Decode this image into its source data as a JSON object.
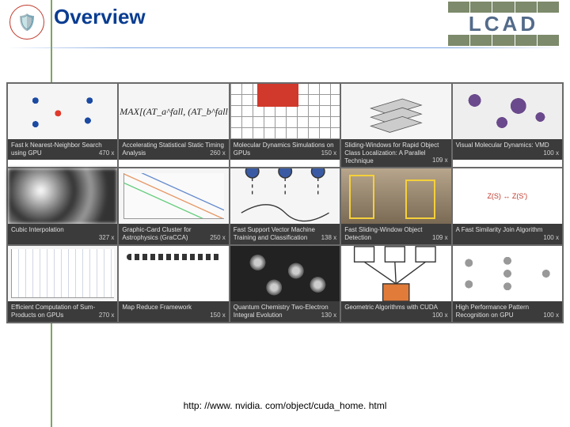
{
  "header": {
    "title": "Overview",
    "lab": "LCAD",
    "crest_glyph": "🛡️"
  },
  "cards": [
    {
      "title": "Fast k Nearest-Neighbor Search using GPU",
      "speed": "470 x"
    },
    {
      "title": "Accelerating Statistical Static Timing Analysis",
      "speed": "260 x"
    },
    {
      "title": "Molecular Dynamics Simulations on GPUs",
      "speed": "150 x"
    },
    {
      "title": "Sliding-Windows for Rapid Object Class Localization: A Parallel Technique",
      "speed": "109 x"
    },
    {
      "title": "Visual Molecular Dynamics: VMD",
      "speed": "100 x"
    },
    {
      "title": "Cubic Interpolation",
      "speed": "327 x"
    },
    {
      "title": "Graphic-Card Cluster for Astrophysics (GraCCA)",
      "speed": "250 x"
    },
    {
      "title": "Fast Support Vector Machine Training and Classification",
      "speed": "138 x"
    },
    {
      "title": "Fast Sliding-Window Object Detection",
      "speed": "109 x"
    },
    {
      "title": "A Fast Similarity Join Algorithm",
      "speed": "100 x"
    },
    {
      "title": "Efficient Computation of Sum-Products on GPUs",
      "speed": "270 x"
    },
    {
      "title": "Map Reduce Framework",
      "speed": "150 x"
    },
    {
      "title": "Quantum Chemistry Two-Electron Integral Evolution",
      "speed": "130 x"
    },
    {
      "title": "Geometric Algorithms with CUDA",
      "speed": "100 x"
    },
    {
      "title": "High Performance Pattern Recognition on GPU",
      "speed": "100 x"
    }
  ],
  "thumb_labels": {
    "math": "MAX[(AT_a^fall, (AT_b^fall",
    "join": "Z(S) ↔ Z(S′)"
  },
  "footer": {
    "url": "http: //www. nvidia. com/object/cuda_home. html"
  }
}
